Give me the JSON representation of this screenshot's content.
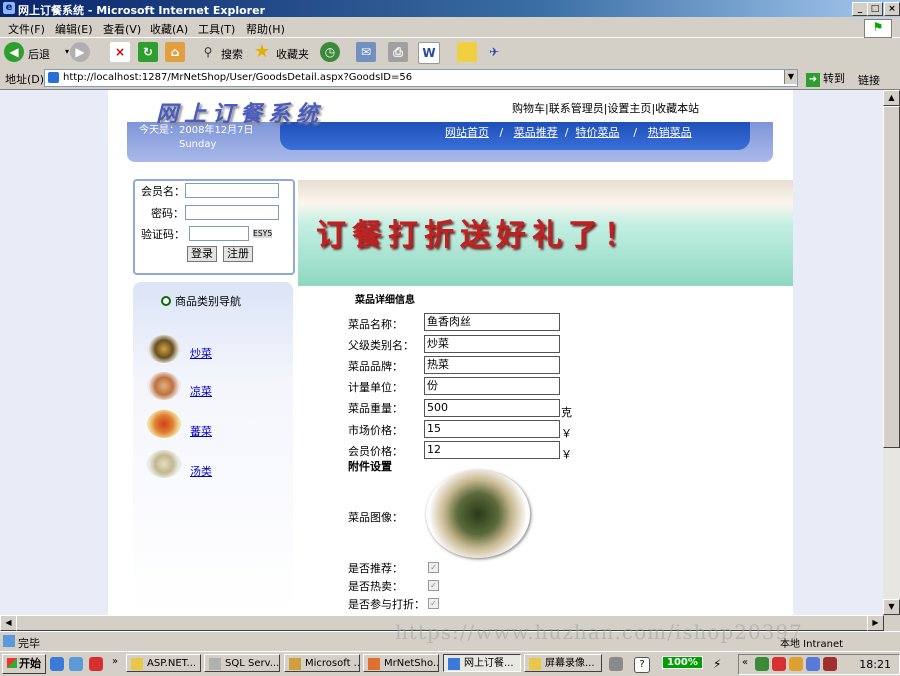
{
  "window": {
    "title": "网上订餐系统 - Microsoft Internet Explorer"
  },
  "menu": [
    "文件(F)",
    "编辑(E)",
    "查看(V)",
    "收藏(A)",
    "工具(T)",
    "帮助(H)"
  ],
  "toolbar": {
    "back": "后退",
    "search": "搜索",
    "favorites": "收藏夹"
  },
  "address": {
    "label": "地址(D)",
    "url": "http://localhost:1287/MrNetShop/User/GoodsDetail.aspx?GoodsID=56",
    "go": "转到",
    "links": "链接"
  },
  "header": {
    "logo": "网上订餐系统",
    "top_links": [
      "购物车",
      "|联系管理员",
      "|设置主页",
      "|收藏本站"
    ],
    "date": "今天是：2008年12月7日",
    "weekday": "Sunday",
    "nav": [
      "网站首页",
      "菜品推荐",
      "特价菜品",
      "热销菜品"
    ]
  },
  "login": {
    "member": "会员名：",
    "password": "密码：",
    "captcha": "验证码：",
    "captcha_code": "ESY5",
    "login_btn": "登录",
    "register_btn": "注册"
  },
  "category": {
    "title": "商品类别导航",
    "items": [
      "炒菜",
      "凉菜",
      "蕃菜",
      "汤类"
    ]
  },
  "banner": {
    "text": "订餐打折送好礼了！"
  },
  "detail": {
    "title": "菜品详细信息",
    "fields": [
      {
        "label": "菜品名称：",
        "value": "鱼香肉丝"
      },
      {
        "label": "父级类别名：",
        "value": "炒菜"
      },
      {
        "label": "菜品品牌：",
        "value": "热菜"
      },
      {
        "label": "计量单位：",
        "value": "份"
      },
      {
        "label": "菜品重量：",
        "value": "500",
        "unit": "克"
      },
      {
        "label": "市场价格：",
        "value": "15",
        "unit": "￥"
      },
      {
        "label": "会员价格：",
        "value": "12",
        "unit": "￥"
      }
    ],
    "attach_title": "附件设置",
    "image_label": "菜品图像：",
    "flags": [
      {
        "label": "是否推荐：",
        "checked": true
      },
      {
        "label": "是否热卖：",
        "checked": true
      },
      {
        "label": "是否参与打折：",
        "checked": true
      }
    ]
  },
  "status": {
    "text": "完毕",
    "zone": "本地 Intranet",
    "watermark": "https://www.huzhan.com/ishop20397"
  },
  "taskbar": {
    "start": "开始",
    "tasks": [
      "ASP.NET...",
      "SQL Serv...",
      "Microsoft ...",
      "MrNetSho...",
      "网上订餐...",
      "屏幕录像..."
    ],
    "zoom": "100%",
    "clock": "18:21"
  }
}
